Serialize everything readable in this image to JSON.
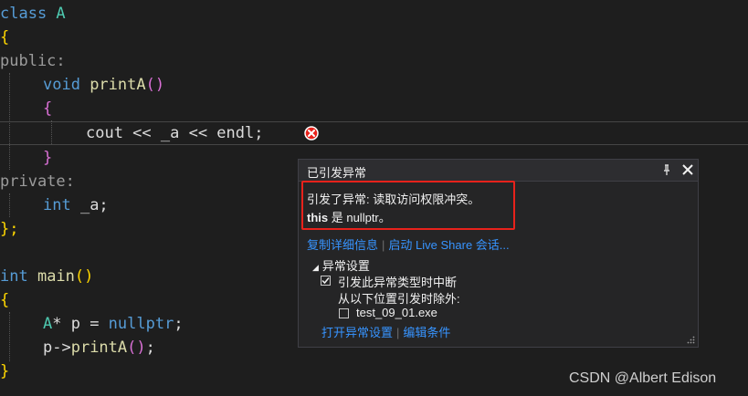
{
  "code": {
    "l1": {
      "a": "class ",
      "b": "A"
    },
    "l2": "{",
    "l3": "public:",
    "l4": {
      "a": "void ",
      "b": "printA",
      "c": "()"
    },
    "l5": "{",
    "l6": "cout << _a << endl;",
    "l7": "}",
    "l8": "private:",
    "l9": {
      "a": "int ",
      "b": "_a;"
    },
    "l10": "};",
    "l11": {
      "a": "int ",
      "b": "main",
      "c": "()"
    },
    "l12": "{",
    "l13": {
      "a": "A",
      "b": "* p = ",
      "c": "nullptr",
      "d": ";"
    },
    "l14": {
      "a": "p->",
      "b": "printA",
      "c": "()",
      "d": ";"
    },
    "l15": "}"
  },
  "exception_popup": {
    "title": "已引发异常",
    "message_line1": "引发了异常: 读取访问权限冲突。",
    "message_line2_bold": "this",
    "message_line2_rest": " 是 nullptr。",
    "link_copy_details": "复制详细信息",
    "link_live_share": "启动 Live Share 会话...",
    "section_title": "异常设置",
    "break_when_thrown": "引发此异常类型时中断",
    "except_when_from": "从以下位置引发时除外:",
    "module_name": "test_09_01.exe",
    "link_open_settings": "打开异常设置",
    "link_edit_conditions": "编辑条件"
  },
  "watermark": "CSDN @Albert Edison",
  "colors": {
    "keyword": "#569cd6",
    "function": "#dcdcaa",
    "error_red": "#e8221b",
    "link": "#3794ff"
  }
}
